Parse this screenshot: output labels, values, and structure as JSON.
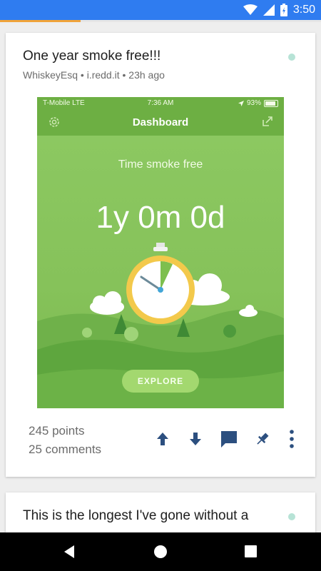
{
  "status_bar": {
    "time": "3:50",
    "icons": [
      "wifi-icon",
      "signal-icon",
      "battery-icon"
    ]
  },
  "post": {
    "title": "One year smoke free!!!",
    "meta": "WhiskeyEsq • i.redd.it • 23h ago",
    "points": "245 points",
    "comments": "25 comments",
    "actions": [
      "upvote-icon",
      "downvote-icon",
      "comment-icon",
      "pin-icon",
      "more-icon"
    ],
    "image": {
      "status_left": "T-Mobile  LTE",
      "status_time": "7:36 AM",
      "status_battery": "93%",
      "nav_title": "Dashboard",
      "label": "Time smoke free",
      "timer": "1y 0m 0d",
      "button": "EXPLORE"
    }
  },
  "next_post": {
    "title": "This is the longest I've gone without a"
  },
  "colors": {
    "status_bar": "#2f7cf0",
    "progress": "#f0a33a",
    "accent_icons": "#2c4f7f",
    "app_green": "#7dbf4e"
  }
}
